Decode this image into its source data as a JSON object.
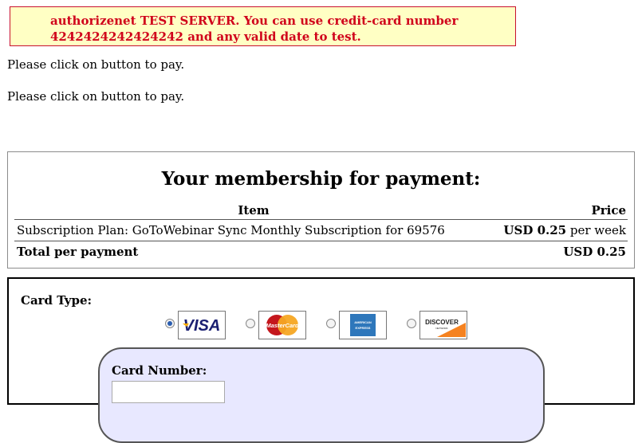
{
  "notice": {
    "line1": "authorizenet TEST SERVER. You can use credit-card number",
    "line2": "4242424242424242 and any valid date to test."
  },
  "messages": [
    "Please click on button to pay.",
    "Please click on button to pay."
  ],
  "membership": {
    "title": "Your membership for payment:",
    "headers": {
      "item": "Item",
      "price": "Price"
    },
    "item": {
      "name": "Subscription Plan: GoToWebinar Sync Monthly Subscription for 69576",
      "price": "USD 0.25",
      "period": "per week"
    },
    "total": {
      "label": "Total per payment",
      "price": "USD 0.25"
    }
  },
  "payment": {
    "card_type_label": "Card Type:",
    "cards": [
      {
        "name": "visa",
        "text": "VISA",
        "selected": true
      },
      {
        "name": "mastercard",
        "text": "MasterCard",
        "selected": false
      },
      {
        "name": "amex",
        "text": "AMERICAN EXPRESS",
        "selected": false
      },
      {
        "name": "discover",
        "text": "DISCOVER",
        "selected": false
      }
    ],
    "card_number_label": "Card Number:",
    "card_number_value": ""
  },
  "colors": {
    "notice_text": "#d0021b",
    "notice_bg": "#ffffc4",
    "number_box_bg": "#e8e8ff"
  }
}
